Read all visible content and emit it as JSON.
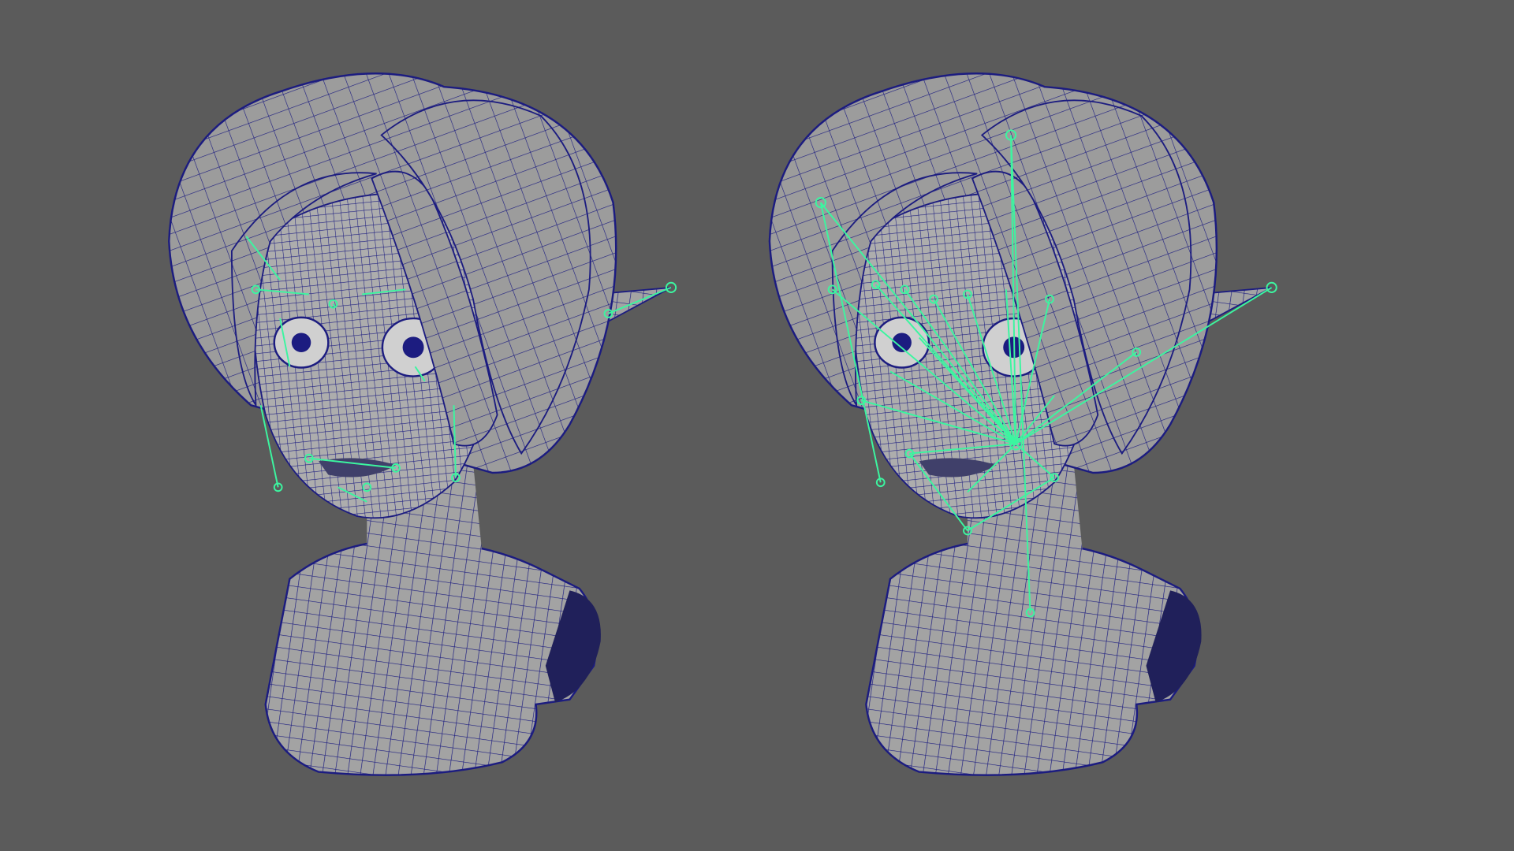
{
  "viewport": {
    "background": "#5b5b5b",
    "mesh_fill": "#a3a3a3",
    "wire_color": "#1c1c80",
    "joint_color": "#3cf5a0"
  },
  "models": [
    {
      "id": "bust-left",
      "joints": "sparse"
    },
    {
      "id": "bust-right",
      "joints": "dense"
    }
  ]
}
